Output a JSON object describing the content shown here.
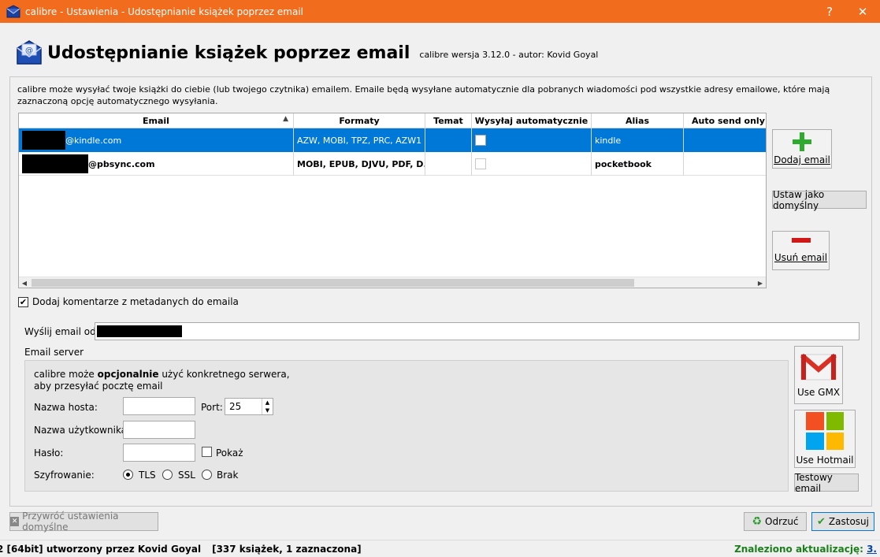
{
  "window": {
    "title": "calibre - Ustawienia - Udostępnianie książek poprzez email",
    "help_label": "?",
    "close_label": "✕"
  },
  "header": {
    "title": "Udostępnianie książek poprzez email",
    "version": "calibre wersja 3.12.0 - autor: Kovid Goyal"
  },
  "intro": "calibre może wysyłać twoje książki do ciebie (lub twojego czytnika) emailem. Emaile będą wysyłane automatycznie dla pobranych wiadomości pod wszystkie adresy emailowe, które mają zaznaczoną opcję automatycznego wysyłania.",
  "table": {
    "columns": [
      "Email",
      "Formaty",
      "Temat",
      "Wysyłaj automatycznie",
      "Alias",
      "Auto send only ta"
    ],
    "rows": [
      {
        "email": "@kindle.com",
        "formats": "AZW, MOBI, TPZ, PRC, AZW1",
        "topic": "",
        "auto": false,
        "alias": "kindle",
        "only": "",
        "selected": true
      },
      {
        "email": "@pbsync.com",
        "formats": "MOBI, EPUB, DJVU, PDF, D...",
        "topic": "",
        "auto": false,
        "alias": "pocketbook",
        "only": "",
        "selected": false
      }
    ]
  },
  "side_buttons": {
    "add": "Dodaj email",
    "set_default": "Ustaw jako domyślny",
    "remove": "Usuń email"
  },
  "metadata_comments": {
    "label": "Dodaj komentarze z metadanych do emaila",
    "checked": true
  },
  "from": {
    "label": "Wyślij email od:",
    "value": ""
  },
  "server": {
    "section_label": "Email server",
    "desc_pre": "calibre może ",
    "desc_bold": "opcjonalnie",
    "desc_post": " użyć konkretnego serwera, aby przesyłać pocztę email",
    "host_label": "Nazwa hosta:",
    "host_value": "",
    "port_label": "Port:",
    "port_value": "25",
    "user_label": "Nazwa użytkownika:",
    "user_value": "",
    "pass_label": "Hasło:",
    "pass_value": "",
    "show_label": "Pokaż",
    "enc_label": "Szyfrowanie:",
    "enc_options": [
      "TLS",
      "SSL",
      "Brak"
    ],
    "enc_selected": "TLS"
  },
  "provider_buttons": {
    "gmx": "Use GMX",
    "hotmail": "Use Hotmail",
    "test": "Testowy email"
  },
  "footer": {
    "restore": "Przywróć ustawienia domyślne",
    "cancel": "Odrzuć",
    "apply": "Zastosuj"
  },
  "status": {
    "left": "2 [64bit] utworzony przez Kovid Goyal",
    "count": "[337 książek, 1 zaznaczona]",
    "update": "Znaleziono aktualizację: ",
    "update_version": "3."
  },
  "colors": {
    "titlebar": "#f26c1d",
    "selection": "#0078d7",
    "update_text": "#1a7f1a"
  }
}
